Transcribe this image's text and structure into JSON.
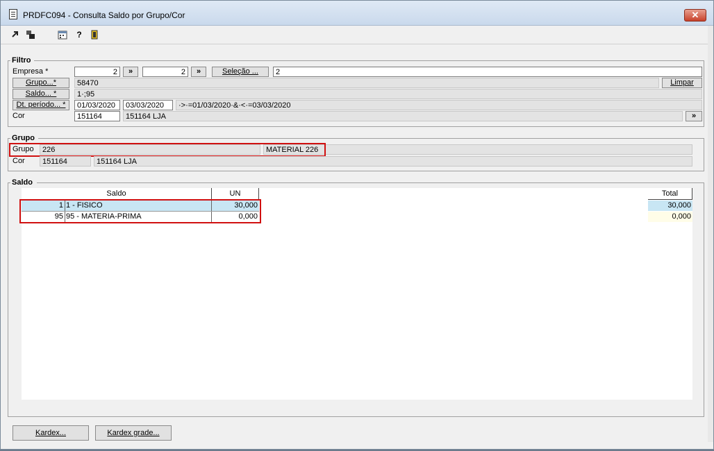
{
  "window": {
    "title": "PRDFC094 - Consulta Saldo por Grupo/Cor",
    "close_label": "✕"
  },
  "toolbar": {
    "icons": [
      "export-icon",
      "windows-icon",
      "calendar-icon",
      "help-icon",
      "exit-icon"
    ]
  },
  "filtro": {
    "title": "Filtro",
    "empresa_label": "Empresa *",
    "empresa_from": "2",
    "empresa_to": "2",
    "arrow_label": "»",
    "selecao_label": "Seleção ...",
    "selecao_value": "2",
    "grupo_label": "Grupo...*",
    "grupo_value": "58470",
    "limpar_label": "Limpar",
    "saldo_label": "Saldo... *",
    "saldo_value": "1·;95",
    "periodo_label": "Dt. período... *",
    "periodo_from": "01/03/2020",
    "periodo_to": "03/03/2020",
    "periodo_expr": "·>·=01/03/2020·&·<·=03/03/2020",
    "cor_label": "Cor",
    "cor_code": "151164",
    "cor_desc": "151164 LJA"
  },
  "grupo": {
    "title": "Grupo",
    "grupo_label": "Grupo",
    "grupo_code": "226",
    "grupo_desc": "MATERIAL 226",
    "cor_label": "Cor",
    "cor_code": "151164",
    "cor_desc": "151164 LJA"
  },
  "saldo": {
    "title": "Saldo",
    "columns": {
      "saldo": "Saldo",
      "un": "UN",
      "total": "Total"
    },
    "rows": [
      {
        "code": "1",
        "desc": "1 - FISICO",
        "un": "30,000",
        "total": "30,000"
      },
      {
        "code": "95",
        "desc": "95 - MATERIA-PRIMA",
        "un": "0,000",
        "total": "0,000"
      }
    ]
  },
  "footer": {
    "kardex_label": "Kardex...",
    "kardex_grade_label": "Kardex grade..."
  }
}
